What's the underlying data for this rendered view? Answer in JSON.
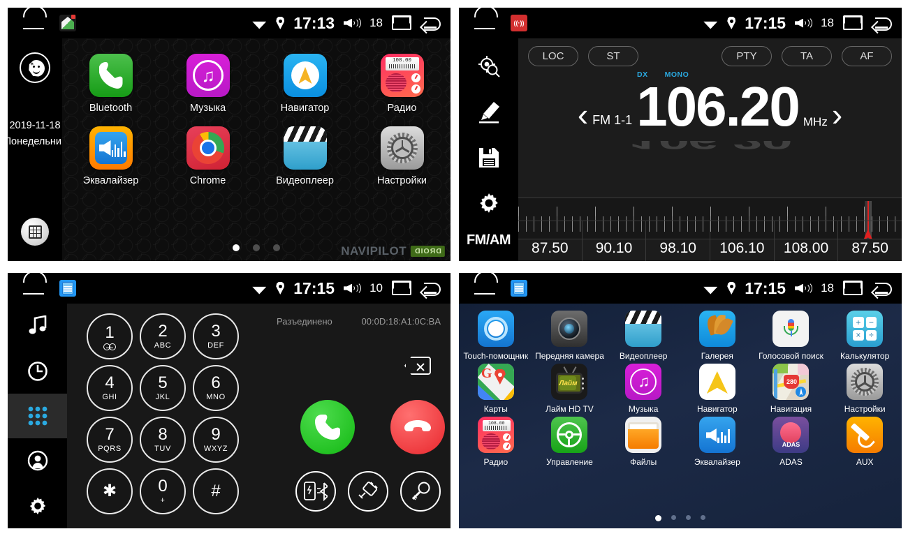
{
  "panels": {
    "home": {
      "status": {
        "time": "17:13",
        "volume": "18",
        "app_badge": "home-app-icon"
      },
      "sidebar": {
        "date": "2019-11-18",
        "day": "Понедельник",
        "night_mode_icon": "moon-icon",
        "apps_icon": "grid-apps-icon"
      },
      "apps": [
        {
          "label": "Bluetooth",
          "icon": "bluetooth-icon"
        },
        {
          "label": "Музыка",
          "icon": "music-icon"
        },
        {
          "label": "Навигатор",
          "icon": "navigator-icon"
        },
        {
          "label": "Радио",
          "icon": "radio-icon",
          "display": "108.00"
        },
        {
          "label": "Эквалайзер",
          "icon": "equalizer-icon"
        },
        {
          "label": "Chrome",
          "icon": "chrome-icon"
        },
        {
          "label": "Видеоплеер",
          "icon": "video-player-icon"
        },
        {
          "label": "Настройки",
          "icon": "settings-icon"
        }
      ],
      "page_dots": {
        "count": 3,
        "active": 0
      },
      "brand": {
        "name": "NAVIPILOT",
        "badge": "DROID"
      }
    },
    "radio": {
      "status": {
        "time": "17:15",
        "volume": "18",
        "app_badge": "radio-app-icon"
      },
      "sidebar": [
        {
          "label": "scan-icon"
        },
        {
          "label": "edit-pen-icon"
        },
        {
          "label": "save-floppy-icon"
        },
        {
          "label": "gear-icon"
        },
        {
          "label": "FM/AM"
        }
      ],
      "buttons_left": [
        "LOC",
        "ST"
      ],
      "buttons_right": [
        "PTY",
        "TA",
        "AF"
      ],
      "flags": [
        "DX",
        "MONO"
      ],
      "band": "FM 1-1",
      "frequency": "106.20",
      "unit": "MHz",
      "prev_icon": "chevron-left-icon",
      "next_icon": "chevron-right-icon",
      "presets": [
        "87.50",
        "90.10",
        "98.10",
        "106.10",
        "108.00",
        "87.50"
      ]
    },
    "dialer": {
      "status": {
        "time": "17:15",
        "volume": "10",
        "app_badge": "phone-app-icon"
      },
      "sidebar": [
        {
          "name": "music-icon",
          "active": false
        },
        {
          "name": "call-history-icon",
          "active": false
        },
        {
          "name": "keypad-icon",
          "active": true
        },
        {
          "name": "contacts-icon",
          "active": false
        },
        {
          "name": "settings-gear-icon",
          "active": false
        }
      ],
      "connection_status": "Разъединено",
      "mac_address": "00:0D:18:A1:0C:BA",
      "keys": [
        {
          "num": "1",
          "sub": ""
        },
        {
          "num": "2",
          "sub": "ABC"
        },
        {
          "num": "3",
          "sub": "DEF"
        },
        {
          "num": "4",
          "sub": "GHI"
        },
        {
          "num": "5",
          "sub": "JKL"
        },
        {
          "num": "6",
          "sub": "MNO"
        },
        {
          "num": "7",
          "sub": "PQRS"
        },
        {
          "num": "8",
          "sub": "TUV"
        },
        {
          "num": "9",
          "sub": "WXYZ"
        },
        {
          "num": "✱",
          "sub": ""
        },
        {
          "num": "0",
          "sub": "+"
        },
        {
          "num": "#",
          "sub": ""
        }
      ],
      "actions": {
        "call": "call-answer-button",
        "hangup": "call-end-button",
        "backspace": "backspace-button",
        "sync": "bluetooth-sync-icon",
        "disconnect": "disconnect-plug-icon",
        "search": "voice-search-icon"
      }
    },
    "apps_drawer": {
      "status": {
        "time": "17:15",
        "volume": "18",
        "app_badge": "phone-app-icon"
      },
      "apps": [
        {
          "label": "Touch-помощник",
          "icon": "touch-assistant-icon"
        },
        {
          "label": "Передняя камера",
          "icon": "front-camera-icon"
        },
        {
          "label": "Видеоплеер",
          "icon": "video-player-icon"
        },
        {
          "label": "Галерея",
          "icon": "gallery-icon"
        },
        {
          "label": "Голосовой поиск",
          "icon": "voice-search-icon"
        },
        {
          "label": "Калькулятор",
          "icon": "calculator-icon"
        },
        {
          "label": "Карты",
          "icon": "google-maps-icon"
        },
        {
          "label": "Лайм HD TV",
          "icon": "lime-tv-icon"
        },
        {
          "label": "Музыка",
          "icon": "music-icon"
        },
        {
          "label": "Навигатор",
          "icon": "navigator-icon"
        },
        {
          "label": "Навигация",
          "icon": "navigation-maps-icon"
        },
        {
          "label": "Настройки",
          "icon": "settings-icon"
        },
        {
          "label": "Радио",
          "icon": "radio-icon"
        },
        {
          "label": "Управление",
          "icon": "steering-control-icon"
        },
        {
          "label": "Файлы",
          "icon": "files-icon"
        },
        {
          "label": "Эквалайзер",
          "icon": "equalizer-icon"
        },
        {
          "label": "ADAS",
          "icon": "adas-icon"
        },
        {
          "label": "AUX",
          "icon": "aux-icon"
        }
      ],
      "calculator_keys": [
        "+",
        "−",
        "×",
        "÷"
      ],
      "lime_tv_text": "Лайм",
      "navigation_shield": "280",
      "adas_text": "ADAS",
      "page_dots": {
        "count": 4,
        "active": 0
      }
    }
  },
  "colors": {
    "accent_blue": "#2aa9e0",
    "call_green": "#13b813",
    "hangup_red": "#e8272d",
    "needle_red": "#e02020",
    "brand_green": "#3f6b18"
  }
}
